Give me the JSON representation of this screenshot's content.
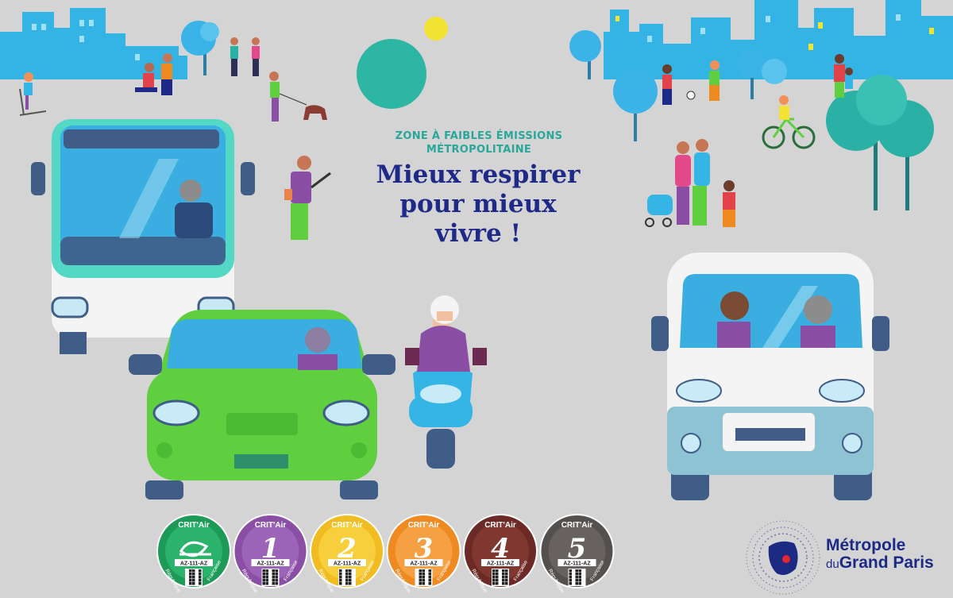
{
  "campaign": {
    "kicker_line1": "ZONE À FAIBLES ÉMISSIONS",
    "kicker_line2": "MÉTROPOLITAINE",
    "headline_line1": "Mieux respirer",
    "headline_line2": "pour mieux",
    "headline_line3": "vivre !"
  },
  "stickers": {
    "brand": "CRIT'Air",
    "plate": "AZ-111-AZ",
    "arc_left": "République",
    "arc_right": "Française",
    "items": [
      {
        "label": "",
        "symbol": "leaf",
        "color": "#1e9a58",
        "inner": "#2bb36c"
      },
      {
        "label": "1",
        "color": "#8a4fa5",
        "inner": "#9c64b8"
      },
      {
        "label": "2",
        "color": "#f1bc22",
        "inner": "#f7cf3c"
      },
      {
        "label": "3",
        "color": "#ef8a22",
        "inner": "#f5a043"
      },
      {
        "label": "4",
        "color": "#6b2a25",
        "inner": "#7f3730"
      },
      {
        "label": "5",
        "color": "#54504e",
        "inner": "#67625f"
      }
    ]
  },
  "logo": {
    "line1": "Métropole",
    "du": "du",
    "line2": "Grand Paris"
  },
  "colors": {
    "background": "#d4d4d4",
    "navy": "#1f2a88",
    "teal": "#2aa79b",
    "city_blue": "#35b5e5",
    "car_green": "#5fcf3f"
  }
}
